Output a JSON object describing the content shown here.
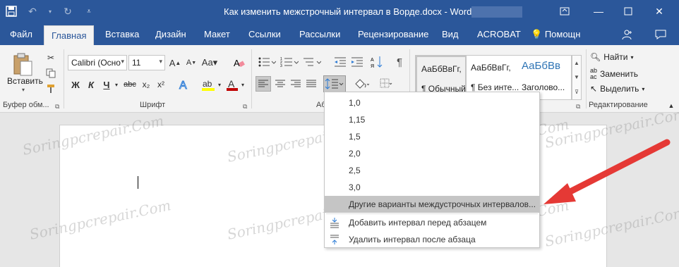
{
  "window": {
    "title": "Как изменить межстрочный интервал в Ворде.docx - Word"
  },
  "tabs": [
    {
      "label": "Файл"
    },
    {
      "label": "Главная"
    },
    {
      "label": "Вставка"
    },
    {
      "label": "Дизайн"
    },
    {
      "label": "Макет"
    },
    {
      "label": "Ссылки"
    },
    {
      "label": "Рассылки"
    },
    {
      "label": "Рецензирование"
    },
    {
      "label": "Вид"
    },
    {
      "label": "ACROBAT"
    },
    {
      "label": "Помощн"
    }
  ],
  "ribbon": {
    "clipboard": {
      "paste_label": "Вставить",
      "group_label": "Буфер обм..."
    },
    "font": {
      "family": "Calibri (Осно",
      "size": "11",
      "group_label": "Шрифт",
      "bold": "Ж",
      "italic": "К",
      "underline": "Ч",
      "strike": "abc",
      "sub": "x₂",
      "sup": "x²"
    },
    "paragraph": {
      "group_label": "Аб"
    },
    "styles": {
      "items": [
        {
          "sample": "АаБбВвГг,",
          "name": "¶ Обычный"
        },
        {
          "sample": "АаБбВвГг,",
          "name": "¶ Без инте..."
        },
        {
          "sample": "АаБбВв",
          "name": "Заголово..."
        }
      ]
    },
    "editing": {
      "find": "Найти",
      "replace": "Заменить",
      "select": "Выделить",
      "group_label": "Редактирование"
    }
  },
  "line_spacing_menu": {
    "options": [
      "1,0",
      "1,15",
      "1,5",
      "2,0",
      "2,5",
      "3,0"
    ],
    "more": "Другие варианты междустрочных интервалов...",
    "add_before": "Добавить интервал перед абзацем",
    "remove_after": "Удалить интервал после абзаца"
  },
  "watermark": "Soringpcrepair.Com",
  "colors": {
    "brand": "#2b579a",
    "highlight": "#ffff00",
    "font_color": "#c00000",
    "arrow": "#e53935"
  }
}
